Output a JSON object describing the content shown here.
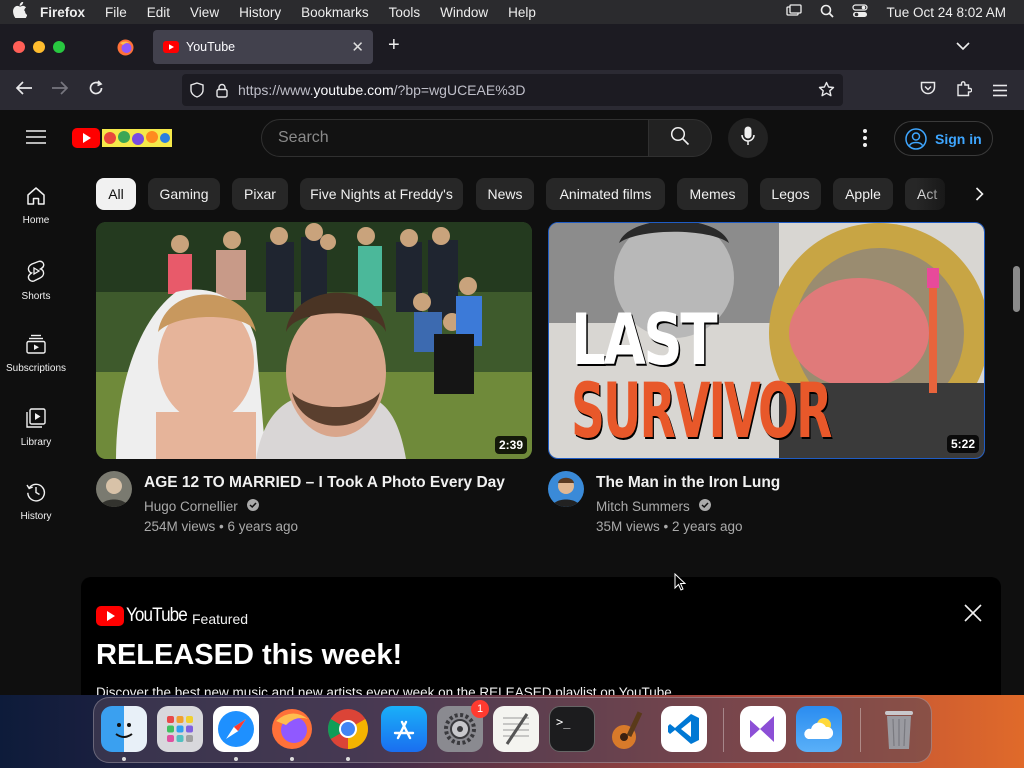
{
  "menubar": {
    "app": "Firefox",
    "items": [
      "File",
      "Edit",
      "View",
      "History",
      "Bookmarks",
      "Tools",
      "Window",
      "Help"
    ],
    "clock": "Tue Oct 24  8:02 AM"
  },
  "browser": {
    "tab_title": "YouTube",
    "url_prefix": "https://www.",
    "url_domain": "youtube.com",
    "url_suffix": "/?bp=wgUCEAE%3D"
  },
  "youtube": {
    "search_placeholder": "Search",
    "sign_in": "Sign in",
    "chips": [
      "All",
      "Gaming",
      "Pixar",
      "Five Nights at Freddy's",
      "News",
      "Animated films",
      "Memes",
      "Legos",
      "Apple",
      "Act"
    ],
    "sidebar": [
      {
        "label": "Home",
        "icon": "home-icon"
      },
      {
        "label": "Shorts",
        "icon": "shorts-icon"
      },
      {
        "label": "Subscriptions",
        "icon": "subscriptions-icon"
      },
      {
        "label": "Library",
        "icon": "library-icon"
      },
      {
        "label": "History",
        "icon": "history-icon"
      }
    ],
    "videos": [
      {
        "title": "AGE 12 TO MARRIED – I Took A Photo Every Day",
        "channel": "Hugo Cornellier",
        "meta": "254M views • 6 years ago",
        "duration": "2:39"
      },
      {
        "title": "The Man in the Iron Lung",
        "channel": "Mitch Summers",
        "meta": "35M views • 2 years ago",
        "duration": "5:22",
        "thumb_text_1": "LAST",
        "thumb_text_2": "SURVIVOR"
      }
    ],
    "featured": {
      "logo_text": "YouTube",
      "label": "Featured",
      "heading": "RELEASED this week!",
      "description": "Discover the best new music and new artists every week on the RELEASED playlist on YouTube."
    }
  },
  "dock": {
    "apps": [
      "finder",
      "launchpad",
      "safari",
      "firefox",
      "chrome",
      "app-store",
      "system-settings",
      "textedit",
      "terminal",
      "garageband",
      "vscode",
      "visual-studio",
      "weather",
      "trash"
    ],
    "settings_badge": "1"
  },
  "colors": {
    "accent": "#3ea6ff",
    "yt_red": "#ff0000",
    "bg": "#0f0f0f"
  }
}
